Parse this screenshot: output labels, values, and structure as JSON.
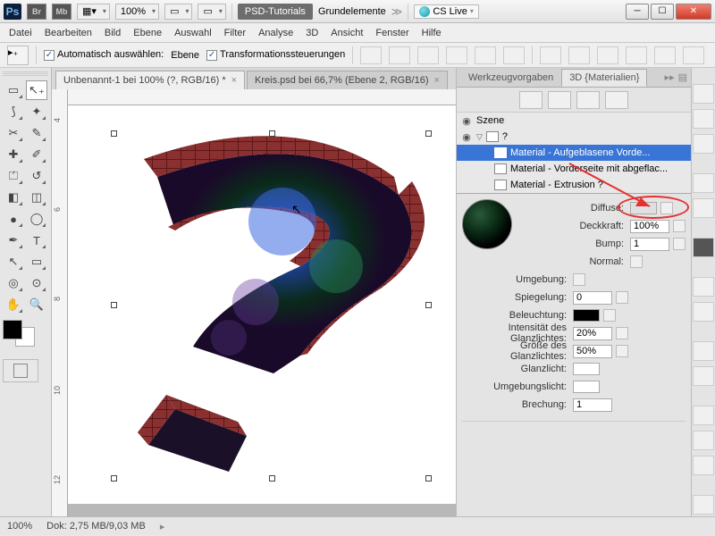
{
  "titlebar": {
    "zoom": "100%",
    "workspace_btn": "PSD-Tutorials",
    "workspace2": "Grundelemente",
    "cslive": "CS Live"
  },
  "menu": {
    "items": [
      "Datei",
      "Bearbeiten",
      "Bild",
      "Ebene",
      "Auswahl",
      "Filter",
      "Analyse",
      "3D",
      "Ansicht",
      "Fenster",
      "Hilfe"
    ]
  },
  "optbar": {
    "auto_select": "Automatisch auswählen:",
    "auto_select_val": "Ebene",
    "transform": "Transformationssteuerungen"
  },
  "tabs": [
    {
      "label": "Unbenannt-1 bei 100% (?, RGB/16) *"
    },
    {
      "label": "Kreis.psd bei 66,7% (Ebene 2, RGB/16)"
    }
  ],
  "panel": {
    "tab1": "Werkzeugvorgaben",
    "tab2": "3D {Materialien}",
    "scene": "Szene",
    "item_root": "?",
    "items": [
      "Material - Aufgeblasene Vorde...",
      "Material - Vorderseite mit abgeflac...",
      "Material - Extrusion ?"
    ],
    "props": {
      "diffuse": "Diffuse:",
      "deckkraft": "Deckkraft:",
      "deckkraft_v": "100%",
      "bump": "Bump:",
      "bump_v": "1",
      "normal": "Normal:",
      "umgebung": "Umgebung:",
      "spiegelung": "Spiegelung:",
      "spiegelung_v": "0",
      "beleuchtung": "Beleuchtung:",
      "glanz_int": "Intensität des Glanzlichtes:",
      "glanz_int_v": "20%",
      "glanz_groesse": "Größe des Glanzlichtes:",
      "glanz_groesse_v": "50%",
      "glanzlicht": "Glanzlicht:",
      "umgebungslicht": "Umgebungslicht:",
      "brechung": "Brechung:",
      "brechung_v": "1"
    }
  },
  "status": {
    "zoom": "100%",
    "doc": "Dok: 2,75 MB/9,03 MB"
  }
}
